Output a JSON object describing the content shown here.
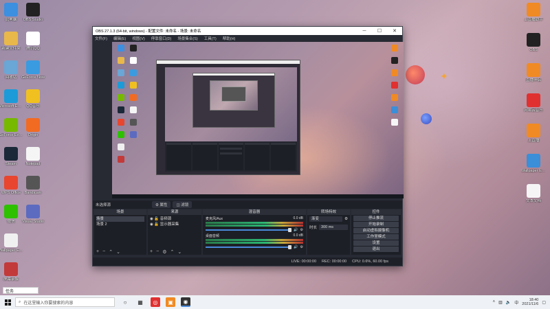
{
  "desktop_left": [
    {
      "label": "此电脑",
      "icon": "computer-icon",
      "color": "#3d8fe0"
    },
    {
      "label": "新建文件夹",
      "icon": "folder-icon",
      "color": "#e8b84a"
    },
    {
      "label": "回收站",
      "icon": "recycle-bin-icon",
      "color": "#6aa6d6"
    },
    {
      "label": "Microsoft Edge",
      "icon": "edge-icon",
      "color": "#1d9bd8"
    },
    {
      "label": "GeForce Experience",
      "icon": "nvidia-icon",
      "color": "#76b900"
    },
    {
      "label": "Steam",
      "icon": "steam-icon",
      "color": "#1b2838"
    },
    {
      "label": "WPS Office",
      "icon": "wps-icon",
      "color": "#e8462f"
    },
    {
      "label": "微信",
      "icon": "wechat-icon",
      "color": "#2dc100"
    },
    {
      "label": "Wallpaper Engine",
      "icon": "wallpaper-icon",
      "color": "#f0f0f0"
    },
    {
      "label": "屏幕录像",
      "icon": "recorder-icon",
      "color": "#c23a3a"
    }
  ],
  "desktop_left2": [
    {
      "label": "OBS Studio",
      "icon": "obs-icon",
      "color": "#222222"
    },
    {
      "label": "腾讯QQ",
      "icon": "qq-icon",
      "color": "#ffffff"
    },
    {
      "label": "GeForce Now",
      "icon": "geforce-icon",
      "color": "#3a9be0"
    },
    {
      "label": "QQ音乐",
      "icon": "music-icon",
      "color": "#f0c020"
    },
    {
      "label": "Origin",
      "icon": "origin-icon",
      "color": "#f26b22"
    },
    {
      "label": "Notepad",
      "icon": "document-icon",
      "color": "#f5f5f5"
    },
    {
      "label": "Bandicam",
      "icon": "bandicam-icon",
      "color": "#555555"
    },
    {
      "label": "Visual Studio",
      "icon": "vs-icon",
      "color": "#5c6bc0"
    }
  ],
  "desktop_right": [
    {
      "label": "上直播助手",
      "icon": "app-icon",
      "color": "#f08a24"
    },
    {
      "label": "OBS",
      "icon": "obs-icon",
      "color": "#222222"
    },
    {
      "label": "直播伴侣",
      "icon": "app-icon",
      "color": "#f08a24"
    },
    {
      "label": "网易云音乐",
      "icon": "netease-music-icon",
      "color": "#e03030"
    },
    {
      "label": "上直播",
      "icon": "app-icon",
      "color": "#f08a24"
    },
    {
      "label": "Wallpaper Engine",
      "icon": "wallpaper-icon",
      "color": "#3b8ed8"
    },
    {
      "label": "文本文档",
      "icon": "document-icon",
      "color": "#f5f5f5"
    }
  ],
  "obs": {
    "title": "OBS 27.1.3 (64-bit, windows) - 配置文件: 未命名 - 场景: 未命名",
    "menu": [
      "文件(F)",
      "编辑(E)",
      "视图(V)",
      "停靠窗口(D)",
      "场景集合(S)",
      "工具(T)",
      "帮助(H)"
    ],
    "no_source": "未选择源",
    "tab_props": "属性",
    "tab_filters": "滤镜",
    "docks": {
      "scenes_title": "场景",
      "scenes": [
        "场景",
        "场景 2"
      ],
      "sources_title": "来源",
      "sources": [
        "音频源",
        "显示器采集"
      ],
      "mixer_title": "混音器",
      "channels": [
        {
          "name": "麦克风/Aux",
          "db": "0.0 dB"
        },
        {
          "name": "桌面音频",
          "db": "0.0 dB"
        }
      ],
      "transitions_title": "转场特效",
      "transition": "渐变",
      "duration_label": "时长",
      "duration": "300 ms",
      "controls_title": "控件",
      "controls": [
        "停止推流",
        "开始录制",
        "启动虚拟摄像机",
        "工作室模式",
        "设置",
        "退出"
      ]
    },
    "status": {
      "live": "LIVE: 00:00:00",
      "rec": "REC: 00:00:00",
      "cpu": "CPU: 0.6%, 60.00 fps"
    }
  },
  "taskbar": {
    "notif": "任务",
    "search_placeholder": "在这里输入你要搜索的内容",
    "time": "18:40",
    "date": "2021/11/6"
  }
}
